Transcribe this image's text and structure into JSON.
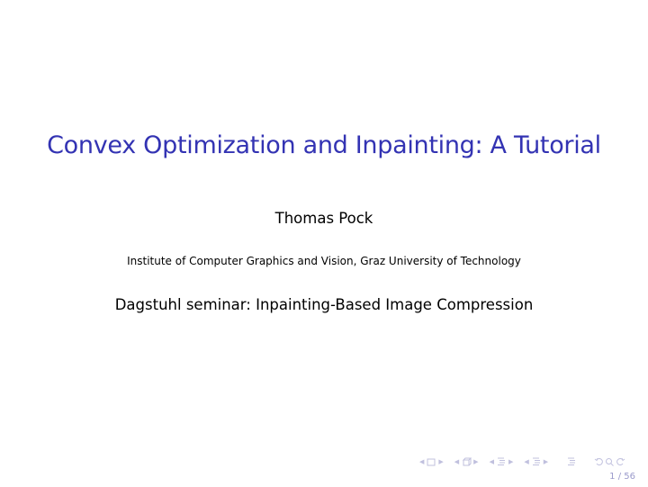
{
  "slide": {
    "title": "Convex Optimization and Inpainting: A Tutorial",
    "author": "Thomas Pock",
    "institute": "Institute of Computer Graphics and Vision, Graz University of Technology",
    "event": "Dagstuhl seminar: Inpainting-Based Image Compression",
    "title_color": "#3333b3"
  },
  "navigation": {
    "icons": [
      "frame-nav-icon",
      "subsection-nav-icon",
      "section-nav-icon",
      "subsection-list-nav-icon",
      "doc-nav-icon",
      "undo-icon",
      "search-icon",
      "redo-icon"
    ],
    "icon_color": "#c0c0de"
  },
  "footer": {
    "page_number": "1 / 56"
  }
}
